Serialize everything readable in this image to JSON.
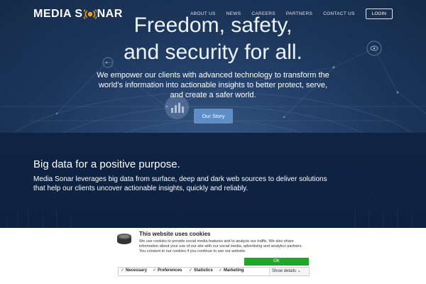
{
  "header": {
    "logo_text_1": "MEDIA S",
    "logo_text_2": "NAR",
    "nav": [
      "ABOUT US",
      "NEWS",
      "CAREERS",
      "PARTNERS",
      "CONTACT US"
    ],
    "login_label": "LOGIN"
  },
  "hero": {
    "headline_line1": "Freedom, safety,",
    "headline_line2": "and security for all.",
    "sub_line1": "We empower our clients with advanced technology to transform the",
    "sub_line2": "world’s  information into actionable insights to better protect, serve,",
    "sub_line3": "and create a safer world.",
    "cta_label": "Our Story"
  },
  "section": {
    "title": "Big data for a positive purpose.",
    "text": "Media Sonar leverages big data from surface, deep and dark web sources to deliver solutions that help our clients uncover actionable insights, quickly and reliably."
  },
  "cookie": {
    "title": "This website uses cookies",
    "text": "We use cookies to provide social media features and to analyze our traffic. We also share information about your use of our site with our social media, advertising and analytics partners. You consent to our cookies if you continue to use our website.",
    "ok_label": "OK",
    "options": [
      "Necessary",
      "Preferences",
      "Statistics",
      "Marketing"
    ],
    "show_details": "Show details"
  },
  "colors": {
    "logo_accent": "#f0a020",
    "ok_green": "#1fa828",
    "cta_blue": "#5d8fc6"
  }
}
